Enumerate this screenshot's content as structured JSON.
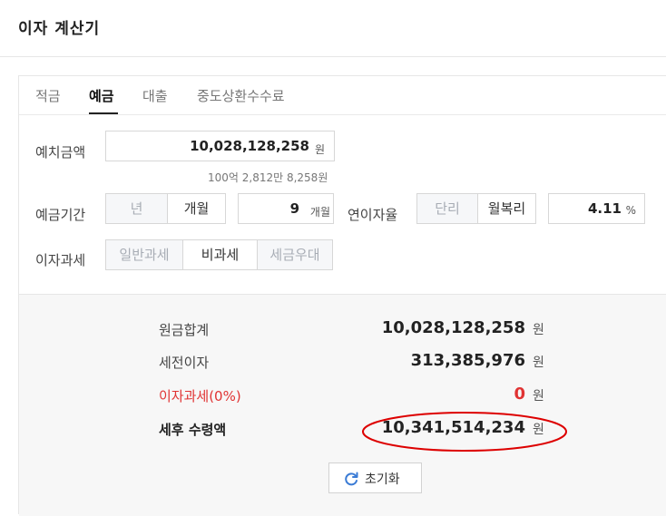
{
  "header": {
    "title": "이자 계산기"
  },
  "tabs": [
    {
      "label": "적금"
    },
    {
      "label": "예금"
    },
    {
      "label": "대출"
    },
    {
      "label": "중도상환수수료"
    }
  ],
  "deposit": {
    "label": "예치금액",
    "value": "10,028,128,258",
    "unit": "원",
    "helper": "100억 2,812만 8,258원"
  },
  "period": {
    "label": "예금기간",
    "options": [
      "년",
      "개월"
    ],
    "selected": "개월",
    "value": "9",
    "unit": "개월"
  },
  "rate": {
    "label": "연이자율",
    "options": [
      "단리",
      "월복리"
    ],
    "selected": "월복리",
    "value": "4.11",
    "unit": "%"
  },
  "tax": {
    "label": "이자과세",
    "options": [
      "일반과세",
      "비과세",
      "세금우대"
    ],
    "selected": "비과세"
  },
  "results": {
    "principal": {
      "label": "원금합계",
      "value": "10,028,128,258",
      "unit": "원"
    },
    "pretax_interest": {
      "label": "세전이자",
      "value": "313,385,976",
      "unit": "원"
    },
    "tax": {
      "label": "이자과세(0%)",
      "value": "0",
      "unit": "원"
    },
    "net": {
      "label": "세후 수령액",
      "value": "10,341,514,234",
      "unit": "원"
    }
  },
  "reset_label": "초기화",
  "colors": {
    "accent_red": "#e03333",
    "annotation_red": "#dd0000",
    "reset_icon_blue": "#3a7bd5"
  }
}
